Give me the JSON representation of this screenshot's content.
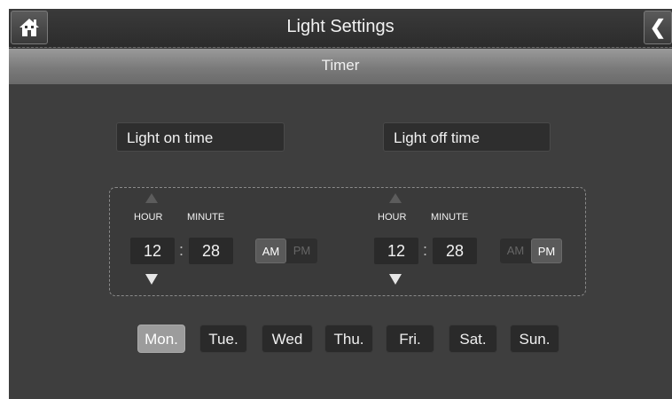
{
  "header": {
    "title": "Light Settings",
    "home_icon": "home-icon",
    "back_icon": "chevron-left-icon",
    "back_glyph": "❮"
  },
  "subheader": {
    "title": "Timer"
  },
  "labels": {
    "on": "Light on time",
    "off": "Light off time"
  },
  "on_time": {
    "hour_label": "HOUR",
    "minute_label": "MINUTE",
    "hour": "12",
    "minute": "28",
    "separator": ":",
    "am": "AM",
    "pm": "PM",
    "selected": "AM"
  },
  "off_time": {
    "hour_label": "HOUR",
    "minute_label": "MINUTE",
    "hour": "12",
    "minute": "28",
    "separator": ":",
    "am": "AM",
    "pm": "PM",
    "selected": "PM"
  },
  "days": [
    {
      "label": "Mon.",
      "selected": true
    },
    {
      "label": "Tue.",
      "selected": false
    },
    {
      "label": "Wed",
      "selected": false
    },
    {
      "label": "Thu.",
      "selected": false
    },
    {
      "label": "Fri.",
      "selected": false
    },
    {
      "label": "Sat.",
      "selected": false
    },
    {
      "label": "Sun.",
      "selected": false
    }
  ]
}
